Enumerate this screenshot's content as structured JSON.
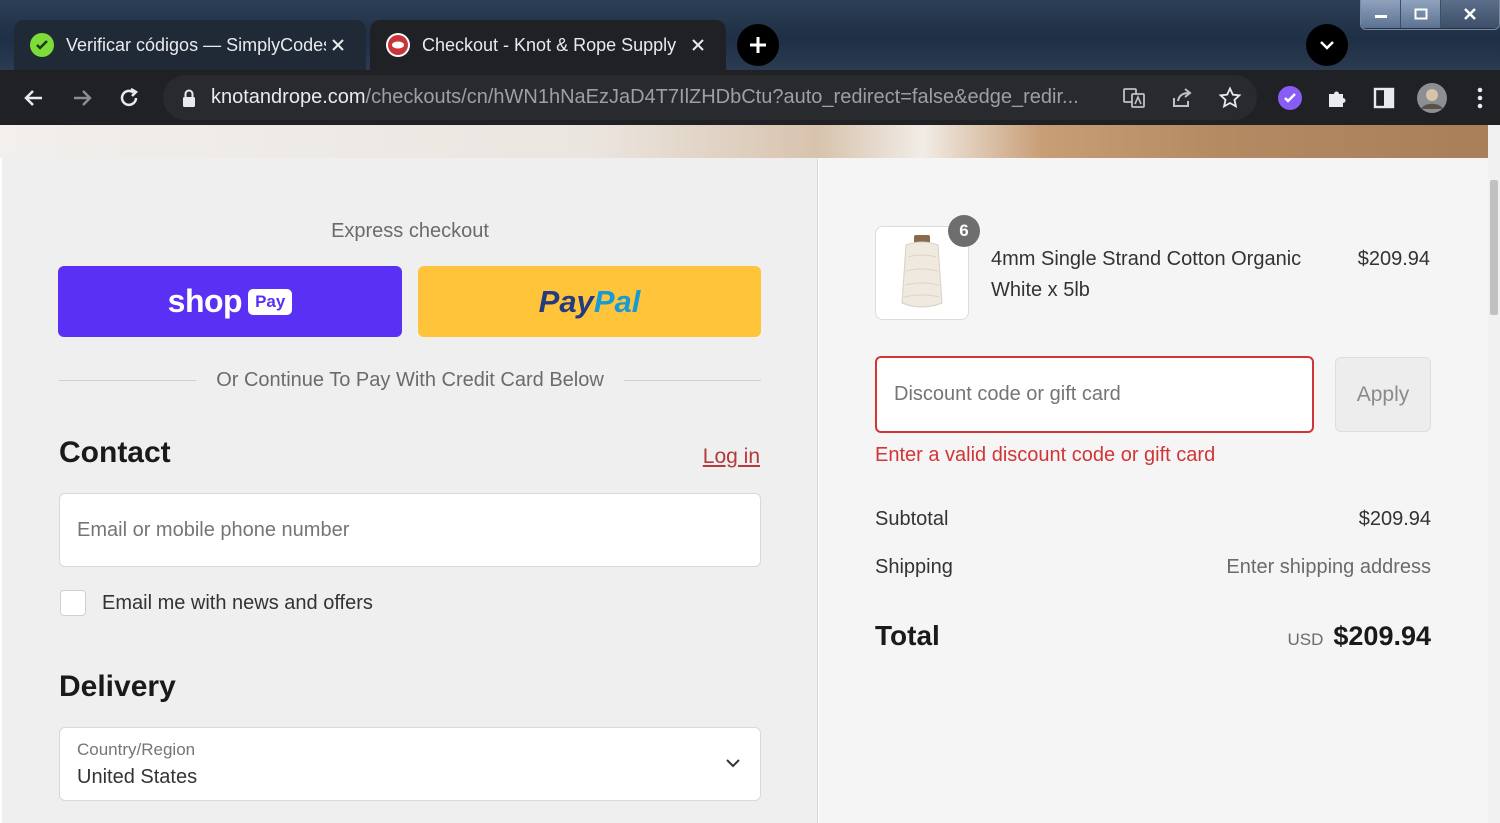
{
  "browser": {
    "tabs": [
      {
        "title": "Verificar códigos — SimplyCodes",
        "active": false,
        "icon": "simplycodes-icon"
      },
      {
        "title": "Checkout - Knot & Rope Supply",
        "active": true,
        "icon": "knotrope-icon"
      }
    ],
    "url_host": "knotandrope.com",
    "url_path": "/checkouts/cn/hWN1hNaEzJaD4T7IlZHDbCtu?auto_redirect=false&edge_redir..."
  },
  "checkout": {
    "express_label": "Express checkout",
    "shoppay_word": "shop",
    "shoppay_badge": "Pay",
    "paypal_1": "Pay",
    "paypal_2": "Pal",
    "divider_text": "Or Continue To Pay With Credit Card Below",
    "contact_heading": "Contact",
    "login_label": "Log in",
    "email_placeholder": "Email or mobile phone number",
    "newsletter_label": "Email me with news and offers",
    "delivery_heading": "Delivery",
    "country_label": "Country/Region",
    "country_value": "United States"
  },
  "summary": {
    "quantity": "6",
    "product_name": "4mm Single Strand Cotton Organic White x 5lb",
    "product_price": "$209.94",
    "discount_placeholder": "Discount code or gift card",
    "apply_label": "Apply",
    "discount_error": "Enter a valid discount code or gift card",
    "subtotal_label": "Subtotal",
    "subtotal_value": "$209.94",
    "shipping_label": "Shipping",
    "shipping_value": "Enter shipping address",
    "total_label": "Total",
    "total_currency": "USD",
    "total_value": "$209.94"
  },
  "colors": {
    "shoppay": "#5a31f4",
    "paypal": "#ffc439",
    "error": "#d23535",
    "link": "#b53a3a"
  }
}
